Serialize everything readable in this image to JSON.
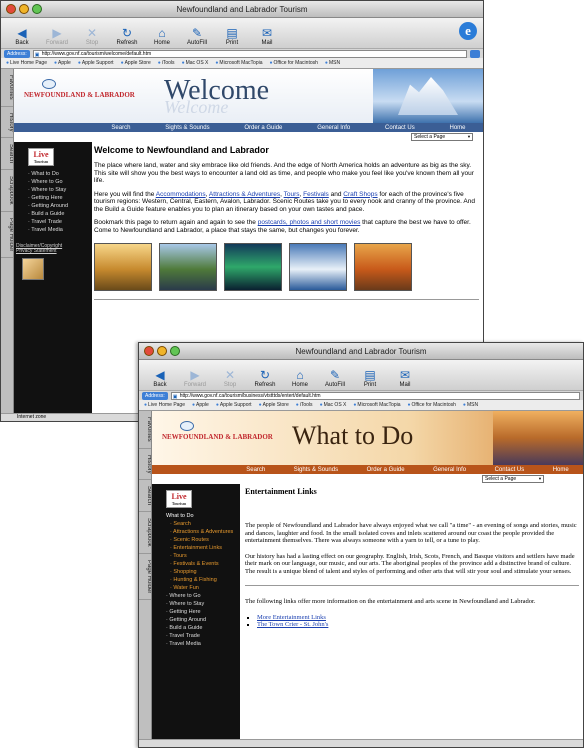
{
  "windows": [
    {
      "title": "Newfoundland and Labrador Tourism",
      "toolbar": [
        {
          "label": "Back",
          "icon": "back-arrow-icon",
          "glyph": "◀"
        },
        {
          "label": "Forward",
          "icon": "forward-arrow-icon",
          "glyph": "▶"
        },
        {
          "label": "Stop",
          "icon": "stop-icon",
          "glyph": "✕"
        },
        {
          "label": "Refresh",
          "icon": "refresh-icon",
          "glyph": "↻"
        },
        {
          "label": "Home",
          "icon": "home-icon",
          "glyph": "⌂"
        },
        {
          "label": "AutoFill",
          "icon": "autofill-icon",
          "glyph": "✎"
        },
        {
          "label": "Print",
          "icon": "print-icon",
          "glyph": "▤"
        },
        {
          "label": "Mail",
          "icon": "mail-icon",
          "glyph": "✉"
        }
      ],
      "address_label": "Address:",
      "url": "http://www.gov.nf.ca/tourism/welcome/default.htm",
      "favorites": [
        "Live Home Page",
        "Apple",
        "Apple Support",
        "Apple Store",
        "iTools",
        "Mac OS X",
        "Microsoft MacTopia",
        "Office for Macintosh",
        "MSN"
      ],
      "side_tabs": [
        "Favorites",
        "History",
        "Search",
        "Scrapbook",
        "Page Holder"
      ],
      "logo": "NEWFOUNDLAND & LABRADOR",
      "headline": "Welcome",
      "headline_ghost": "Welcome",
      "nav": [
        "Search",
        "Sights & Sounds",
        "Order a Guide",
        "General Info",
        "Contact Us",
        "Home"
      ],
      "select": "Select a Page",
      "live_badge": "Live",
      "live_sub": "Tourism",
      "menu": [
        "What to Do",
        "Where to Go",
        "Where to Stay",
        "Getting Here",
        "Getting Around",
        "Build a Guide",
        "Travel Trade",
        "Travel Media"
      ],
      "disclaimer": [
        "Disclaimer/Copyright",
        "Privacy Statement"
      ],
      "heading": "Welcome to Newfoundland and Labrador",
      "p1": "The place where land, water and sky embrace like old friends. And the edge of North America holds an adventure as big as the sky. This site will show you the best ways to encounter a land old as time, and people who make you feel like you've known them all your life.",
      "p2_pre": "Here you will find the ",
      "p2_links": [
        "Accommodations",
        "Attractions & Adventures",
        "Tours",
        "Festivals",
        "Craft Shops"
      ],
      "p2_post": "for each of the province's five tourism regions: Western, Central, Eastern, Avalon, Labrador. Scenic Routes take you to every nook and cranny of the province. And the Build a Guide feature enables you to plan an itinerary based on your own tastes and pace.",
      "p3_pre": "Bookmark this page to return again and again to see the ",
      "p3_link": "postcards, photos and short movies",
      "p3_post": " that capture the best we have to offer. Come to Newfoundland and Labrador, a place that stays the same, but changes you forever.",
      "status": "Internet zone"
    },
    {
      "title": "Newfoundland and Labrador Tourism",
      "url": "http://www.gov.nf.ca/tourism/business/vtstttds/entert/default.htm",
      "headline": "What to Do",
      "menu": [
        {
          "t": "What to Do",
          "c": "cur"
        },
        {
          "t": "Search",
          "c": "sub"
        },
        {
          "t": "Attractions & Adventures",
          "c": "sub"
        },
        {
          "t": "Scenic Routes",
          "c": "sub"
        },
        {
          "t": "Entertainment Links",
          "c": "sub"
        },
        {
          "t": "Tours",
          "c": "sub"
        },
        {
          "t": "Festivals & Events",
          "c": "sub"
        },
        {
          "t": "Shopping",
          "c": "sub"
        },
        {
          "t": "Hunting & Fishing",
          "c": "sub"
        },
        {
          "t": "Water Fun",
          "c": "sub"
        },
        {
          "t": "Where to Go",
          "c": ""
        },
        {
          "t": "Where to Stay",
          "c": ""
        },
        {
          "t": "Getting Here",
          "c": ""
        },
        {
          "t": "Getting Around",
          "c": ""
        },
        {
          "t": "Build a Guide",
          "c": ""
        },
        {
          "t": "Travel Trade",
          "c": ""
        },
        {
          "t": "Travel Media",
          "c": ""
        }
      ],
      "heading": "Entertainment Links",
      "p1": "The people of Newfoundland and Labrador have always enjoyed what we call \"a time\" - an evening of songs and stories, music and dances, laughter and food. In the small isolated coves and inlets scattered around our coast the people provided the entertainment themselves. There was always someone with a yarn to tell, or a tune to play.",
      "p2": "Our history has had a lasting effect on our geography. English, Irish, Scots, French, and Basque visitors and settlers have made their mark on our language, our music, and our arts. The aboriginal peoples of the province add a distinctive brand of culture. The result is a unique blend of talent and styles of performing and other arts that will stir your soul and stimulate your senses.",
      "p3": "The following links offer more information on the entertainment and arts scene in Newfoundland and Labrador.",
      "links": [
        "More Entertainment Links",
        "The Town Crier - St. John's"
      ]
    }
  ]
}
